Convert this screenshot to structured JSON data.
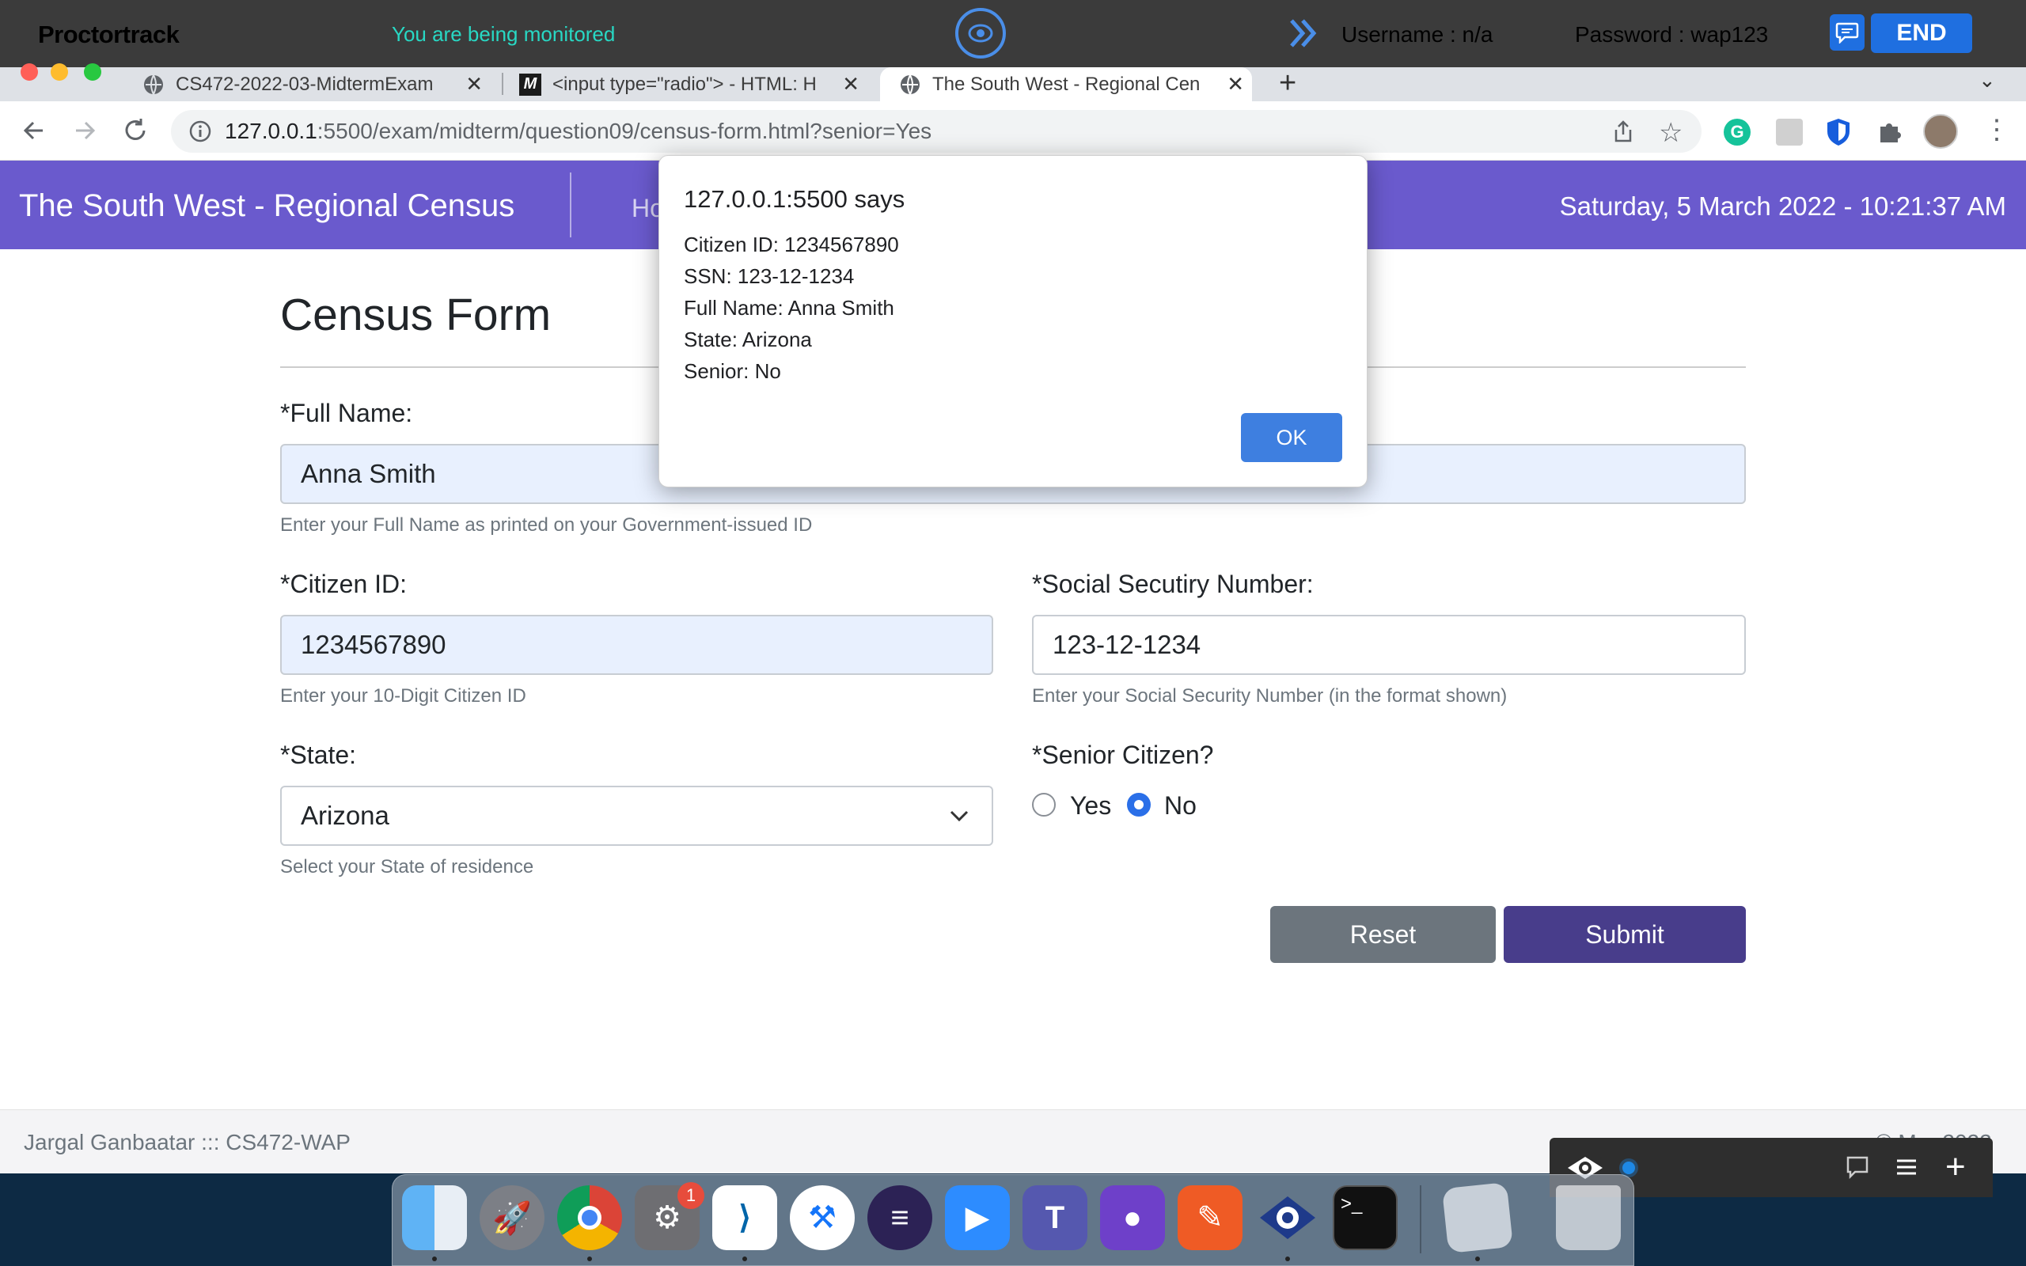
{
  "proctor": {
    "logo": "Proctortrack",
    "monitor_text": "You are being monitored",
    "username": "Username : n/a",
    "password": "Password : wap123",
    "end_label": "END"
  },
  "browser": {
    "tabs": [
      {
        "title": "CS472-2022-03-MidtermExam",
        "icon": "globe-icon"
      },
      {
        "title": "<input type=\"radio\"> - HTML: H",
        "icon": "mdn-icon"
      },
      {
        "title": "The South West - Regional Cen",
        "icon": "globe-icon"
      }
    ],
    "url_host": "127.0.0.1",
    "url_rest": ":5500/exam/midterm/question09/census-form.html?senior=Yes"
  },
  "site": {
    "brand": "The South West - Regional Census",
    "nav_home": "Ho",
    "datetime": "Saturday, 5 March 2022 - 10:21:37 AM"
  },
  "form": {
    "title": "Census Form",
    "fullname_label": "*Full Name:",
    "fullname_value": "Anna Smith",
    "fullname_help": "Enter your Full Name as printed on your Government-issued ID",
    "citizen_label": "*Citizen ID:",
    "citizen_value": "1234567890",
    "citizen_help": "Enter your 10-Digit Citizen ID",
    "ssn_label": "*Social Secutiry Number:",
    "ssn_value": "123-12-1234",
    "ssn_help": "Enter your Social Security Number (in the format shown)",
    "state_label": "*State:",
    "state_value": "Arizona",
    "state_help": "Select your State of residence",
    "senior_label": "*Senior Citizen?",
    "senior_yes": "Yes",
    "senior_no": "No",
    "reset_label": "Reset",
    "submit_label": "Submit"
  },
  "footer": {
    "left": "Jargal Ganbaatar ::: CS472-WAP",
    "right": "© Mar 2022"
  },
  "dialog": {
    "title": "127.0.0.1:5500 says",
    "lines": [
      "Citizen ID: 1234567890",
      "SSN: 123-12-1234",
      "Full Name: Anna Smith",
      "State: Arizona",
      "Senior: No"
    ],
    "ok_label": "OK"
  },
  "dock": {
    "badge": "1",
    "apps": [
      "finder-icon",
      "launchpad-icon",
      "chrome-icon",
      "system-preferences-icon",
      "vscode-icon",
      "xcode-icon",
      "eclipse-icon",
      "zoom-icon",
      "teams-icon",
      "github-desktop-icon",
      "postman-icon",
      "proctortrack-icon",
      "terminal-icon",
      "preview-icon",
      "trash-icon"
    ]
  }
}
